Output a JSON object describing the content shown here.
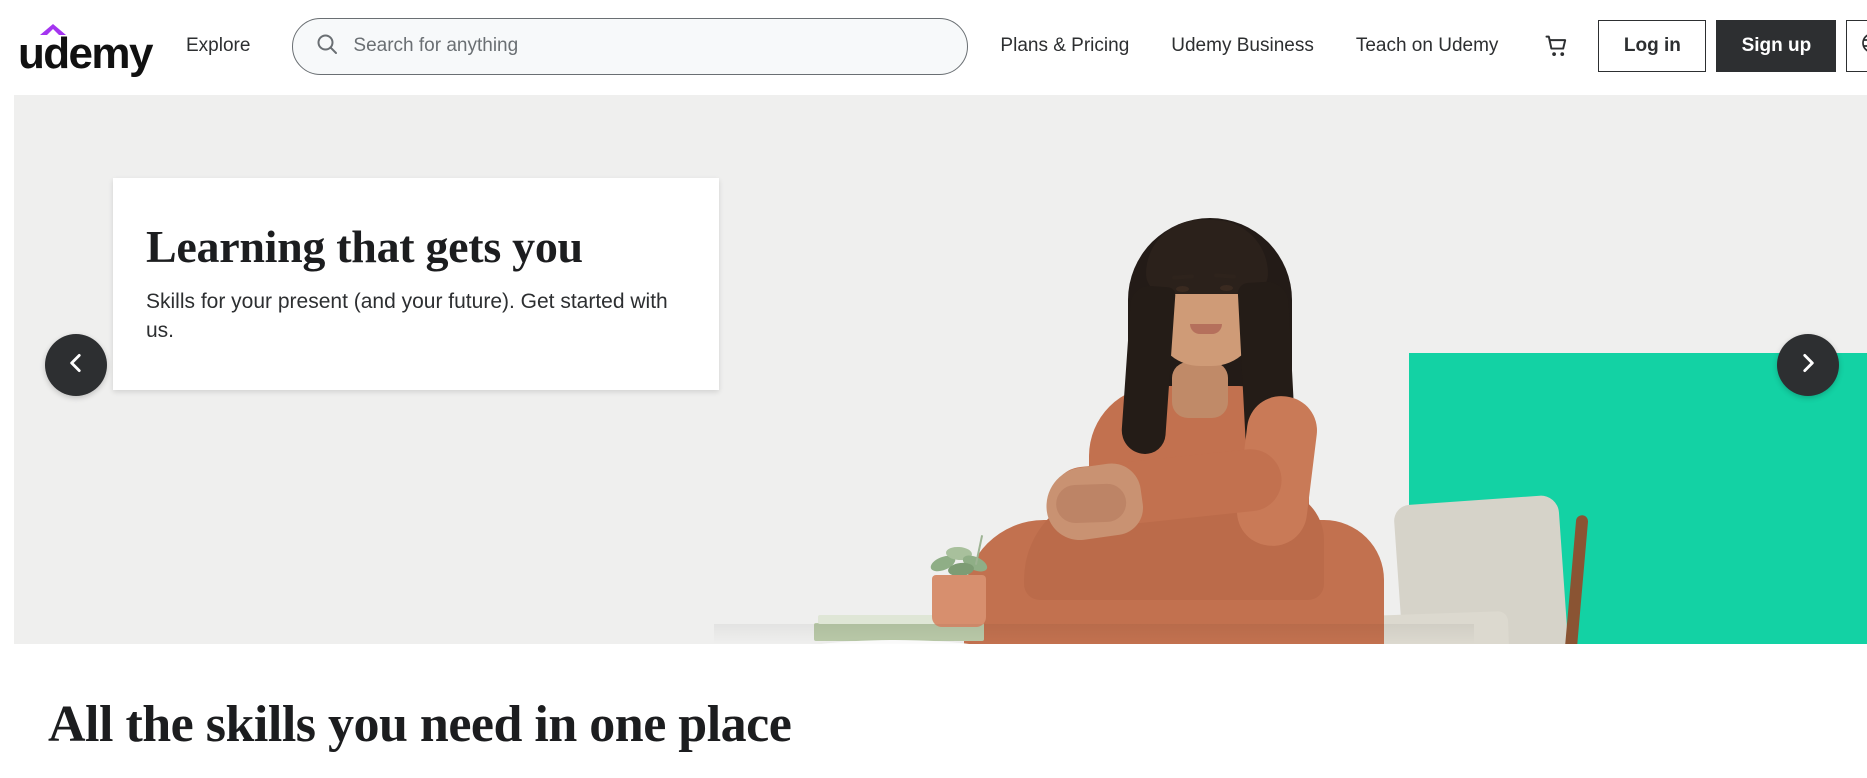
{
  "header": {
    "logo_text": "udemy",
    "logo_accent_color": "#a435f0",
    "explore_label": "Explore",
    "search": {
      "placeholder": "Search for anything",
      "value": "",
      "icon": "search-icon"
    },
    "nav_links": [
      {
        "label": "Plans & Pricing"
      },
      {
        "label": "Udemy Business"
      },
      {
        "label": "Teach on Udemy"
      }
    ],
    "cart_icon": "shopping-cart-icon",
    "login_label": "Log in",
    "signup_label": "Sign up",
    "language_icon": "globe-icon"
  },
  "hero": {
    "title": "Learning that gets you",
    "subtitle": "Skills for your present (and your future). Get started with us.",
    "prev_icon": "chevron-left-icon",
    "next_icon": "chevron-right-icon",
    "background_color": "#eeeeee",
    "accent_color": "#13d2a4"
  },
  "section": {
    "title": "All the skills you need in one place"
  },
  "colors": {
    "brand_purple": "#a435f0",
    "dark": "#2d2f31",
    "teal": "#13d2a4",
    "hero_bg": "#eeeeee"
  }
}
